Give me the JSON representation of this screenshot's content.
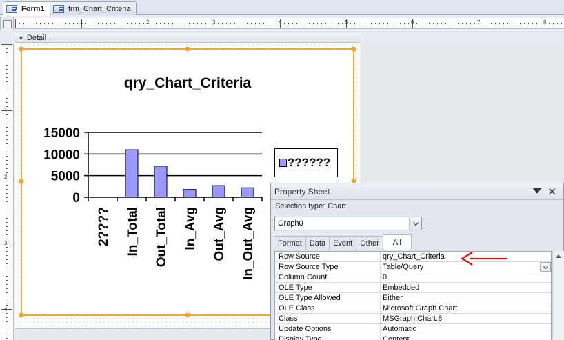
{
  "tabs": [
    {
      "label": "Form1",
      "icon": "form-icon",
      "active": true
    },
    {
      "label": "frm_Chart_Criteria",
      "icon": "form-icon",
      "active": false
    }
  ],
  "ruler": {
    "h_numbers": [
      "1",
      "2",
      "3",
      "4",
      "5",
      "6",
      "7",
      "8"
    ],
    "v_numbers": [
      "1",
      "2",
      "3",
      "4"
    ]
  },
  "section": {
    "label": "Detail",
    "icon": "section-arrow-icon"
  },
  "chart": {
    "legend_label": "??????",
    "colors": {
      "bar": "#9999ff",
      "border": "#000000",
      "selection": "#f0a830"
    }
  },
  "chart_data": {
    "type": "bar",
    "title": "qry_Chart_Criteria",
    "categories": [
      "2????",
      "In_Total",
      "Out_Total",
      "In_Avg",
      "Out_Avg",
      "In_Out_Avg"
    ],
    "series": [
      {
        "name": "??????",
        "values": [
          0,
          11000,
          7200,
          1800,
          2700,
          2200
        ]
      }
    ],
    "y_ticks": [
      "0",
      "5000",
      "10000",
      "15000"
    ],
    "ylim": [
      0,
      15000
    ],
    "grid": true,
    "legend": "right"
  },
  "property_sheet": {
    "title": "Property Sheet",
    "selection_type_label": "Selection type:",
    "selection_type_value": "Chart",
    "object_name": "Graph0",
    "tabs": [
      "Format",
      "Data",
      "Event",
      "Other",
      "All"
    ],
    "active_tab": "All",
    "rows": [
      {
        "name": "Row Source",
        "value": "qry_Chart_Criteria"
      },
      {
        "name": "Row Source Type",
        "value": "Table/Query"
      },
      {
        "name": "Column Count",
        "value": "0"
      },
      {
        "name": "OLE Type",
        "value": "Embedded"
      },
      {
        "name": "OLE Type Allowed",
        "value": "Either"
      },
      {
        "name": "OLE Class",
        "value": "Microsoft Graph Chart"
      },
      {
        "name": "Class",
        "value": "MSGraph.Chart.8"
      },
      {
        "name": "Update Options",
        "value": "Automatic"
      },
      {
        "name": "Display Type",
        "value": "Content"
      }
    ],
    "annotation_color": "#e01010"
  }
}
